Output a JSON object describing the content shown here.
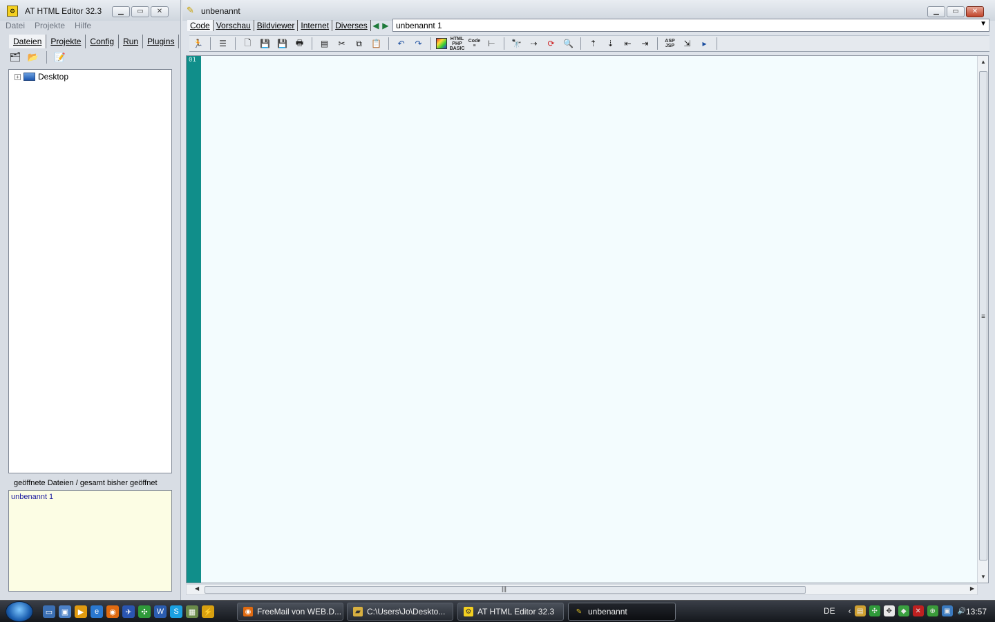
{
  "left_window": {
    "title": "AT HTML Editor 32.3",
    "menu": [
      "Datei",
      "Projekte",
      "Hilfe"
    ],
    "tabs": [
      "Dateien",
      "Projekte",
      "Config",
      "Run",
      "Plugins"
    ],
    "tree_root": "Desktop",
    "opened_files_label": "geöffnete Dateien / gesamt bisher geöffnet",
    "opened_files": [
      "unbenannt 1"
    ]
  },
  "main_window": {
    "title": "unbenannt",
    "nav_tabs": [
      "Code",
      "Vorschau",
      "Bildviewer",
      "Internet",
      "Diverses"
    ],
    "document_select": "unbenannt 1",
    "line_number": "01",
    "toolbar_labels": {
      "html_php_basic": [
        "HTML",
        "PHP",
        "BASIC"
      ],
      "code": [
        "Code"
      ],
      "asp_jsp": [
        "ASP",
        "JSP"
      ]
    }
  },
  "taskbar": {
    "buttons": [
      "FreeMail von WEB.D...",
      "C:\\Users\\Jo\\Deskto...",
      "AT HTML Editor 32.3",
      "unbenannt"
    ],
    "language": "DE",
    "clock": "13:57"
  },
  "colors": {
    "gutter": "#108e8a",
    "editor_bg": "#f3fcfe",
    "opened_files_bg": "#fcfde4",
    "opened_file_text": "#1a1aa0",
    "close_button": "#c0442a"
  }
}
